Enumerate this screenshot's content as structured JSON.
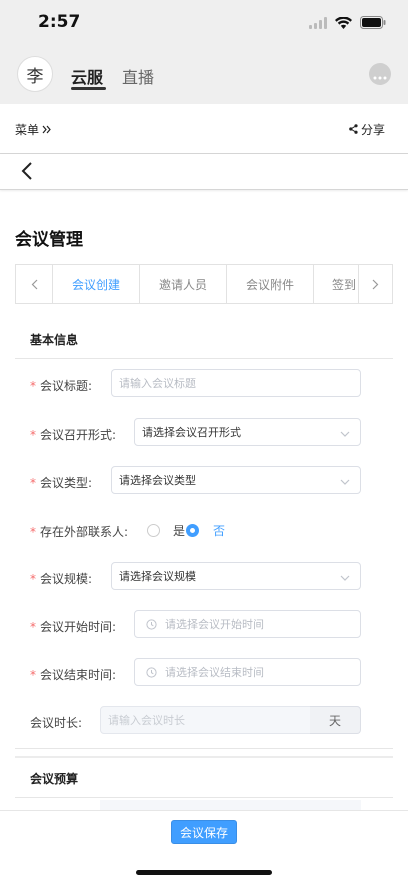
{
  "status_bar": {
    "time": "2:57"
  },
  "header": {
    "avatar_text": "李",
    "tabs": [
      {
        "label": "云服",
        "active": true
      },
      {
        "label": "直播",
        "active": false
      }
    ]
  },
  "menu_bar": {
    "menu_label": "菜单",
    "share_label": "分享"
  },
  "page": {
    "title": "会议管理"
  },
  "tabs": [
    {
      "label": "会议创建",
      "active": true
    },
    {
      "label": "邀请人员",
      "active": false
    },
    {
      "label": "会议附件",
      "active": false
    },
    {
      "label": "签到",
      "active": false
    }
  ],
  "basic_info": {
    "section_title": "基本信息",
    "fields": {
      "title": {
        "label": "会议标题:",
        "placeholder": "请输入会议标题"
      },
      "format": {
        "label": "会议召开形式:",
        "value": "请选择会议召开形式"
      },
      "type": {
        "label": "会议类型:",
        "value": "请选择会议类型"
      },
      "external_contact": {
        "label": "存在外部联系人:",
        "option_yes": "是",
        "option_no": "否",
        "selected": "否"
      },
      "scale": {
        "label": "会议规模:",
        "value": "请选择会议规模"
      },
      "start_time": {
        "label": "会议开始时间:",
        "placeholder": "请选择会议开始时间"
      },
      "end_time": {
        "label": "会议结束时间:",
        "placeholder": "请选择会议结束时间"
      },
      "duration": {
        "label": "会议时长:",
        "placeholder": "请输入会议时长",
        "unit": "天"
      }
    }
  },
  "budget": {
    "section_title": "会议预算"
  },
  "footer": {
    "save_label": "会议保存"
  },
  "colors": {
    "accent": "#409eff",
    "required": "#f56c6c",
    "header_bg": "#efefef"
  }
}
